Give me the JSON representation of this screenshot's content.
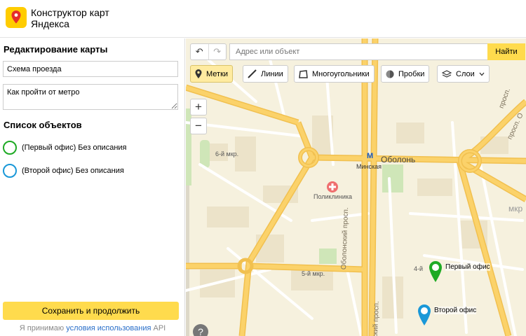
{
  "header": {
    "brand_line1": "Конструктор карт",
    "brand_line2": "Яндекса"
  },
  "sidebar": {
    "title": "Редактирование карты",
    "map_name_value": "Схема проезда",
    "map_desc_value": "Как пройти от метро",
    "objects_title": "Список объектов",
    "objects": [
      {
        "label": "(Первый офис) Без описания",
        "color": "#1eaa24"
      },
      {
        "label": "(Второй офис) Без описания",
        "color": "#1a98d8"
      }
    ],
    "save_label": "Сохранить и продолжить",
    "terms_prefix": "Я принимаю",
    "terms_link": "условия использования",
    "terms_suffix": "API"
  },
  "map": {
    "search_placeholder": "Адрес или объект",
    "search_button": "Найти",
    "toolbar": {
      "marks": "Метки",
      "lines": "Линии",
      "polygons": "Многоугольники",
      "traffic": "Пробки",
      "layers": "Слои"
    },
    "zoom_in": "+",
    "zoom_out": "−",
    "labels": {
      "district_6": "6-й мкр.",
      "district_5": "5-й мкр.",
      "district_4": "4-й",
      "obolon": "Оболонь",
      "minskaya": "Минская",
      "metro": "М",
      "clinic": "Поликлиника",
      "mkr_right": "мкр",
      "prospect_right": "просп.",
      "prospect_top": "просп. О",
      "obolonsky_1": "Оболонский просп.",
      "obolonsky_2": "ский просп."
    },
    "pins": [
      {
        "label": "Первый офис",
        "color": "#1eaa24"
      },
      {
        "label": "Второй офис",
        "color": "#1a98d8"
      }
    ],
    "colors": {
      "road_major": "#fbd26a",
      "road_minor": "#ffffff",
      "background": "#f6f1de",
      "park": "#cfe6b8"
    }
  }
}
